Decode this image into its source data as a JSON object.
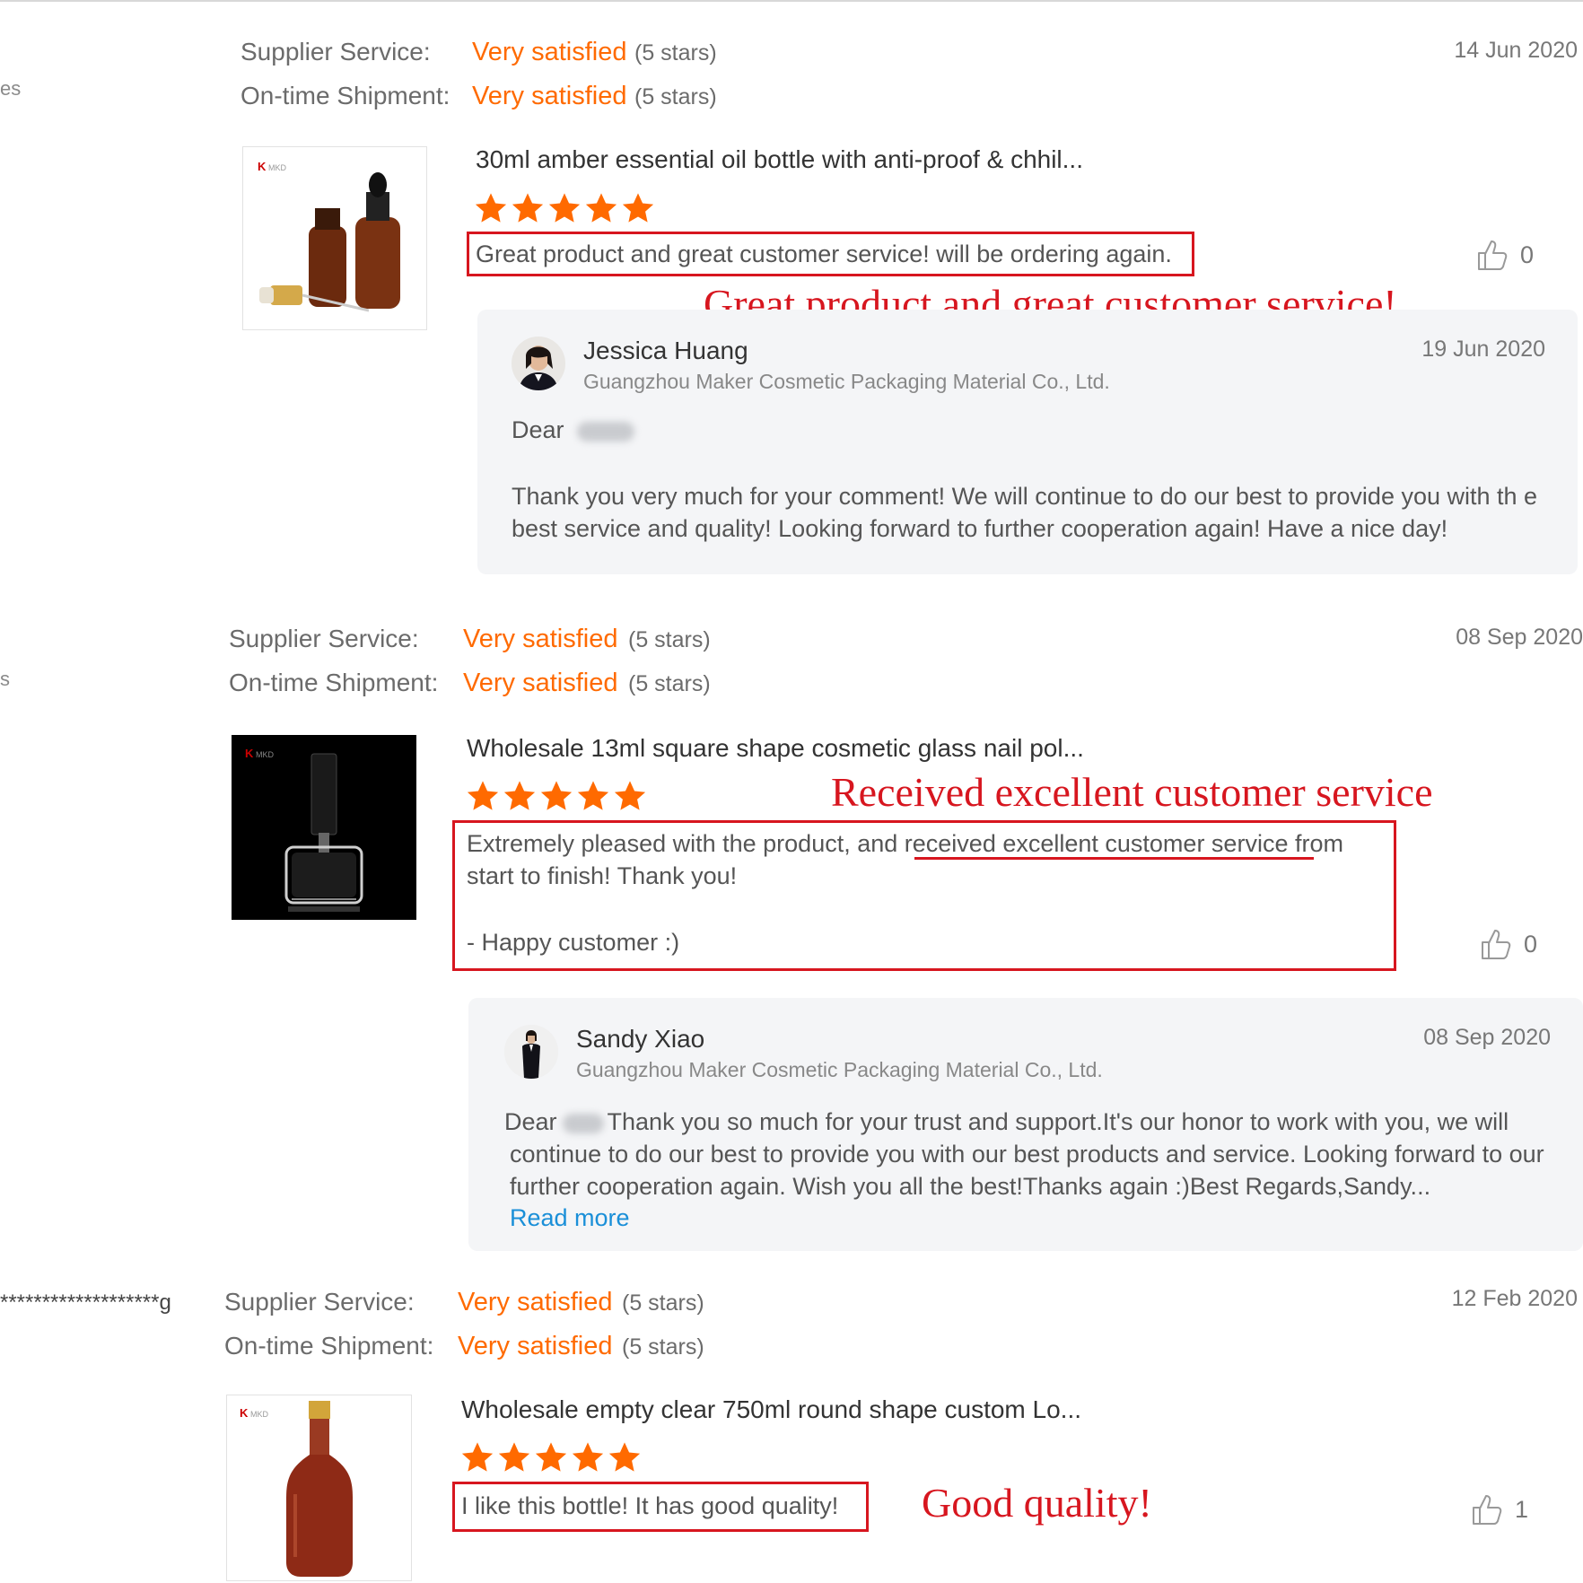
{
  "colors": {
    "accent": "#ff6a00",
    "annotation_red": "#d7161f",
    "link_blue": "#1a8fd8"
  },
  "left_fragments": [
    "es",
    "s",
    "*******************g"
  ],
  "reviews": [
    {
      "supplier_label": "Supplier Service:",
      "supplier_value": "Very satisfied",
      "supplier_stars": "(5 stars)",
      "shipment_label": "On-time Shipment:",
      "shipment_value": "Very satisfied",
      "shipment_stars": "(5 stars)",
      "date": "14 Jun 2020",
      "product_title": "30ml amber essential oil bottle with anti-proof & chhil...",
      "rating": 5,
      "text": "Great product and great customer service! will be ordering again.",
      "likes": "0",
      "annotation": "Great product and great customer service!",
      "reply": {
        "name": "Jessica Huang",
        "company": "Guangzhou Maker Cosmetic Packaging Material Co., Ltd.",
        "date": "19 Jun 2020",
        "greeting": "Dear",
        "text": "Thank you very much for your comment! We will continue to do our best to provide you with th e best service and quality! Looking forward to further cooperation again! Have a nice day!"
      }
    },
    {
      "supplier_label": "Supplier Service:",
      "supplier_value": "Very satisfied",
      "supplier_stars": "(5 stars)",
      "shipment_label": "On-time Shipment:",
      "shipment_value": "Very satisfied",
      "shipment_stars": "(5 stars)",
      "date": "08 Sep 2020",
      "product_title": "Wholesale 13ml square shape cosmetic glass nail pol...",
      "rating": 5,
      "text_before": "Extremely pleased with the product, and ",
      "text_highlight": "received excellent customer service",
      "text_after": " from",
      "text_line2": "start to finish! Thank you!",
      "text_sign": "- Happy customer :)",
      "likes": "0",
      "annotation": "Received excellent customer service",
      "reply": {
        "name": "Sandy Xiao",
        "company": "Guangzhou Maker Cosmetic Packaging Material Co., Ltd.",
        "date": "08 Sep 2020",
        "greeting": "Dear",
        "text_line1": "Thank you so much for your trust and support.It's our honor to work with you, we will",
        "text_rest": "continue to do our best to provide you with our best products and service. Looking forward to our further cooperation again. Wish you all the best!Thanks again :)Best Regards,Sandy...",
        "read_more": "Read more"
      }
    },
    {
      "supplier_label": "Supplier Service:",
      "supplier_value": "Very satisfied",
      "supplier_stars": "(5 stars)",
      "shipment_label": "On-time Shipment:",
      "shipment_value": "Very satisfied",
      "shipment_stars": "(5 stars)",
      "date": "12 Feb 2020",
      "product_title": "Wholesale empty clear 750ml round shape custom Lo...",
      "rating": 5,
      "text": "I like this bottle! It has good quality!",
      "likes": "1",
      "annotation": "Good quality!"
    }
  ]
}
